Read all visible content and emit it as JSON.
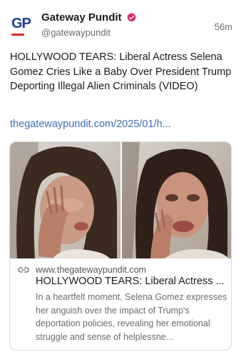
{
  "post": {
    "author": {
      "display_name": "Gateway Pundit",
      "handle": "@gatewaypundit",
      "avatar_text": "GP",
      "verified": true,
      "verified_badge_color": "#e0245e"
    },
    "timestamp": "56m",
    "text": "HOLLYWOOD TEARS: Liberal Actress Selena Gomez Cries Like a Baby Over President Trump Deporting Illegal Alien Criminals (VIDEO)",
    "link_text": "thegatewaypundit.com/2025/01/h...",
    "link_color": "#3b6fb6"
  },
  "card": {
    "icon": "link-icon",
    "domain": "www.thegatewaypundit.com",
    "title": "HOLLYWOOD TEARS: Liberal Actress ...",
    "description": "In a heartfelt moment, Selena Gomez expresses her anguish over the impact of Trump's deportation policies, revealing her emotional struggle and sense of helplessne...",
    "images": [
      "video-still-left",
      "video-still-right"
    ]
  }
}
